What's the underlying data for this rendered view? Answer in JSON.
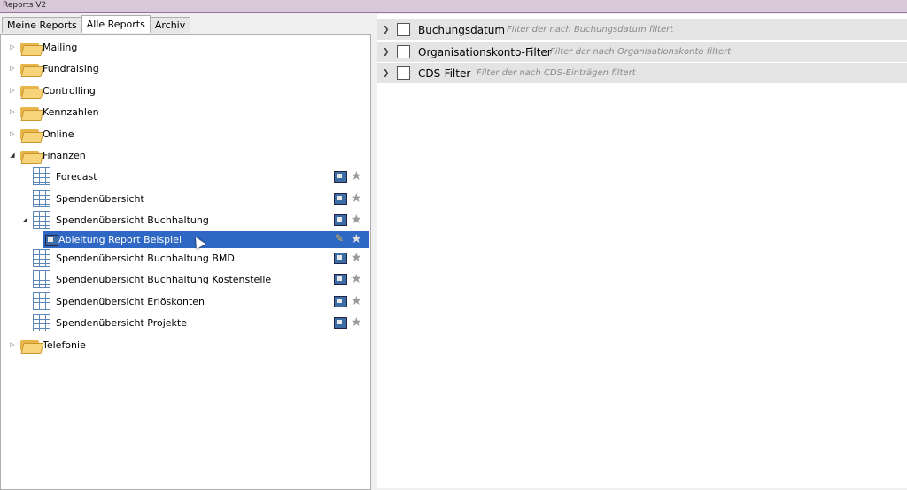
{
  "window": {
    "title": "Reports V2"
  },
  "tabs": [
    {
      "label": "Meine Reports",
      "active": false
    },
    {
      "label": "Alle Reports",
      "active": true
    },
    {
      "label": "Archiv",
      "active": false
    }
  ],
  "tree": {
    "folders": [
      {
        "label": "Mailing",
        "expanded": false
      },
      {
        "label": "Fundraising",
        "expanded": false
      },
      {
        "label": "Controlling",
        "expanded": false
      },
      {
        "label": "Kennzahlen",
        "expanded": false
      },
      {
        "label": "Online",
        "expanded": false
      },
      {
        "label": "Finanzen",
        "expanded": true
      },
      {
        "label": "Telefonie",
        "expanded": false
      }
    ],
    "reports": [
      {
        "label": "Forecast"
      },
      {
        "label": "Spendenübersicht"
      },
      {
        "label": "Spendenübersicht Buchhaltung",
        "expanded": true
      },
      {
        "label": "Ableitung Report Beispiel",
        "selected": true
      },
      {
        "label": "Spendenübersicht Buchhaltung BMD"
      },
      {
        "label": "Spendenübersicht Buchhaltung Kostenstelle"
      },
      {
        "label": "Spendenübersicht Erlöskonten"
      },
      {
        "label": "Spendenübersicht Projekte"
      }
    ]
  },
  "filters": [
    {
      "name": "Buchungsdatum",
      "description": "Filter der nach Buchungsdatum filtert"
    },
    {
      "name": "Organisationskonto-Filter",
      "description": "Filter der nach Organisationskonto filtert"
    },
    {
      "name": "CDS-Filter",
      "description": "Filter der nach CDS-Einträgen filtert"
    }
  ],
  "colors": {
    "selection": "#2f68c4",
    "titlebar_border": "#9c6f9c"
  }
}
